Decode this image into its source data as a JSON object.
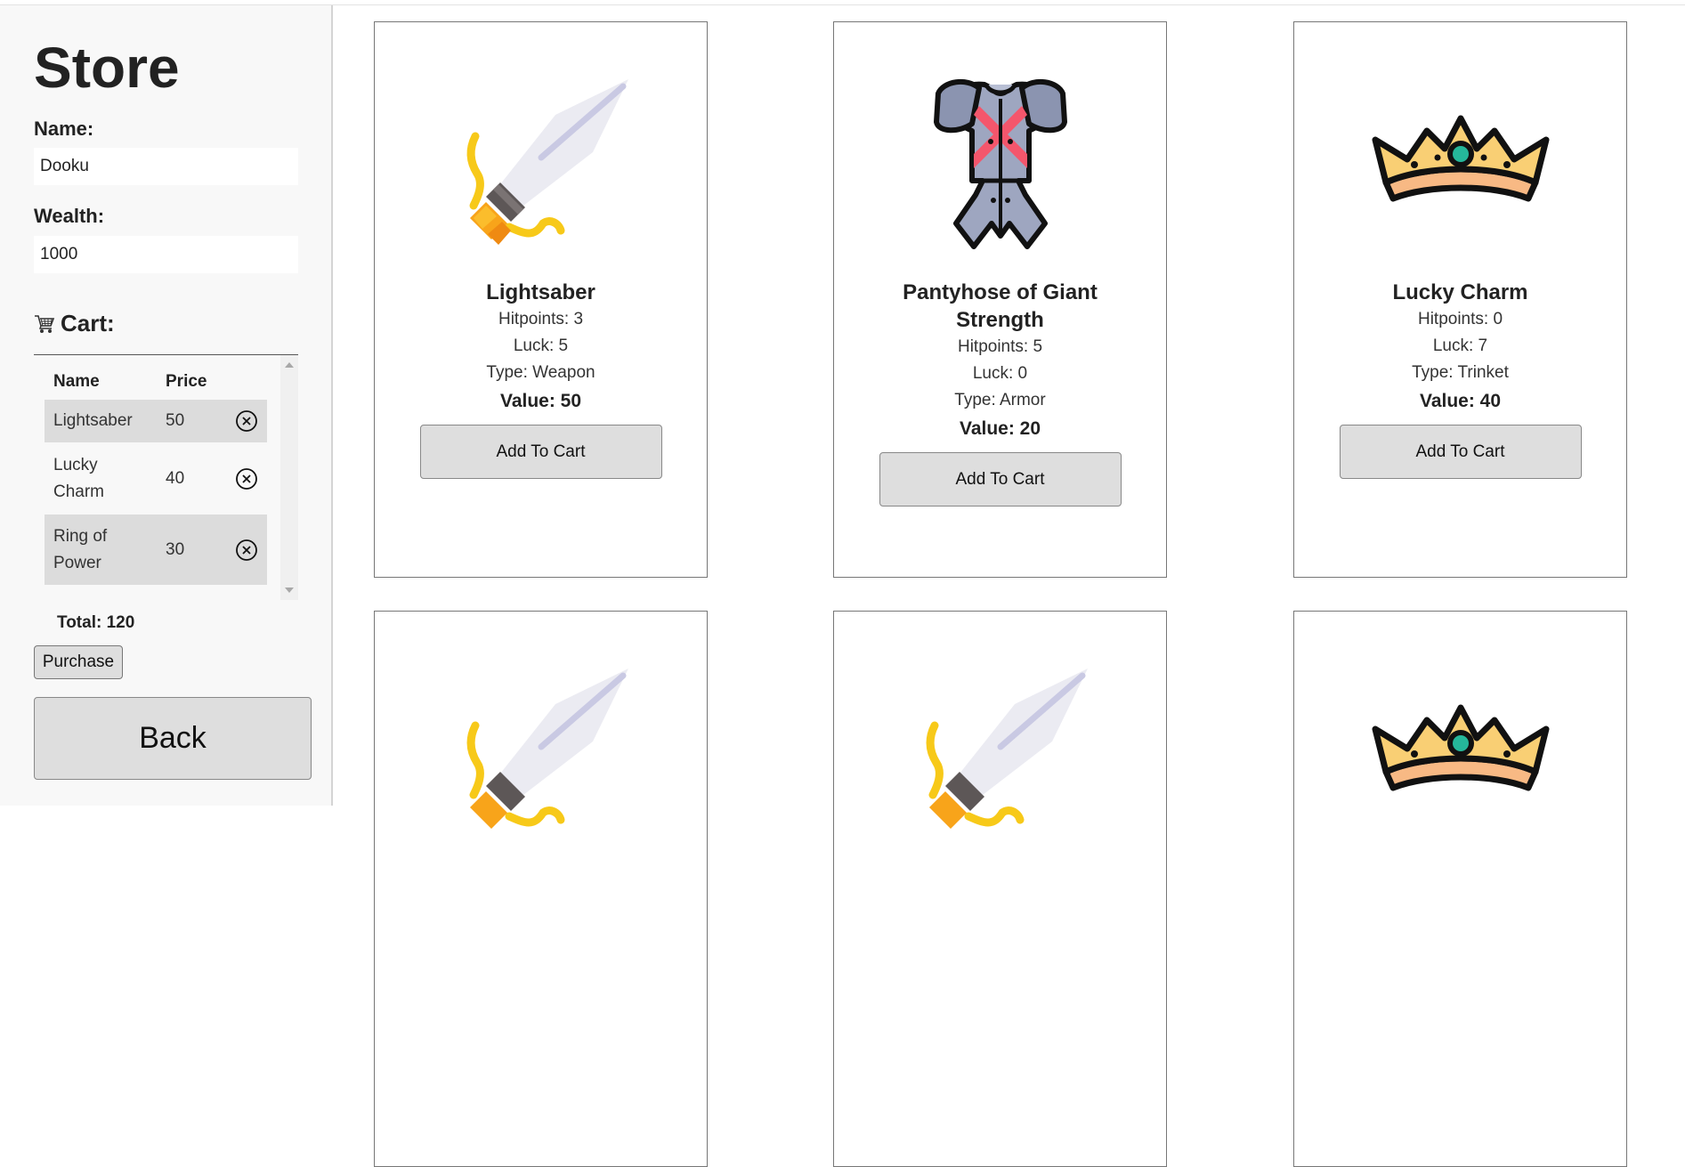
{
  "sidebar": {
    "title": "Store",
    "name_label": "Name:",
    "name_value": "Dooku",
    "wealth_label": "Wealth:",
    "wealth_value": "1000",
    "cart_label": "Cart:",
    "cart_columns": [
      "Name",
      "Price"
    ],
    "cart_items": [
      {
        "name": "Lightsaber",
        "price": "50"
      },
      {
        "name": "Lucky Charm",
        "price": "40"
      },
      {
        "name": "Ring of Power",
        "price": "30"
      }
    ],
    "total": "Total: 120",
    "purchase_label": "Purchase",
    "back_label": "Back"
  },
  "products": [
    {
      "icon": "sword-icon",
      "name": "Lightsaber",
      "hitpoints": "Hitpoints: 3",
      "luck": "Luck: 5",
      "type": "Type: Weapon",
      "value": "Value: 50",
      "button": "Add To Cart"
    },
    {
      "icon": "armor-icon",
      "name": "Pantyhose of Giant Strength",
      "hitpoints": "Hitpoints: 5",
      "luck": "Luck: 0",
      "type": "Type: Armor",
      "value": "Value: 20",
      "button": "Add To Cart"
    },
    {
      "icon": "crown-icon",
      "name": "Lucky Charm",
      "hitpoints": "Hitpoints: 0",
      "luck": "Luck: 7",
      "type": "Type: Trinket",
      "value": "Value: 40",
      "button": "Add To Cart"
    },
    {
      "icon": "sword-icon"
    },
    {
      "icon": "sword-icon"
    },
    {
      "icon": "crown-icon"
    }
  ]
}
